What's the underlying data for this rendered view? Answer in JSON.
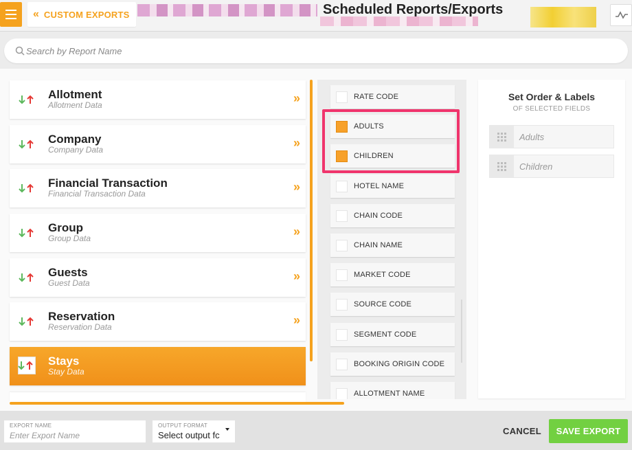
{
  "header": {
    "menu_icon": "hamburger-icon",
    "back_label": "CUSTOM EXPORTS",
    "title": "Scheduled Reports/Exports",
    "activity_icon": "activity-icon"
  },
  "search": {
    "placeholder": "Search by Report Name",
    "icon": "search-icon"
  },
  "categories": [
    {
      "name": "Allotment",
      "sub": "Allotment Data"
    },
    {
      "name": "Company",
      "sub": "Company Data"
    },
    {
      "name": "Financial Transaction",
      "sub": "Financial Transaction Data"
    },
    {
      "name": "Group",
      "sub": "Group Data"
    },
    {
      "name": "Guests",
      "sub": "Guest Data"
    },
    {
      "name": "Reservation",
      "sub": "Reservation Data"
    },
    {
      "name": "Stays",
      "sub": "Stay Data",
      "selected": true
    }
  ],
  "category_open_icon": "»",
  "fields": [
    {
      "label": "RATE CODE",
      "checked": false
    },
    {
      "label": "ADULTS",
      "checked": true
    },
    {
      "label": "CHILDREN",
      "checked": true
    },
    {
      "label": "HOTEL NAME",
      "checked": false
    },
    {
      "label": "CHAIN CODE",
      "checked": false
    },
    {
      "label": "CHAIN NAME",
      "checked": false
    },
    {
      "label": "MARKET CODE",
      "checked": false
    },
    {
      "label": "SOURCE CODE",
      "checked": false
    },
    {
      "label": "SEGMENT CODE",
      "checked": false
    },
    {
      "label": "BOOKING ORIGIN CODE",
      "checked": false
    },
    {
      "label": "ALLOTMENT NAME",
      "checked": false
    }
  ],
  "order_panel": {
    "title": "Set Order & Labels",
    "subtitle": "OF SELECTED FIELDS",
    "items": [
      "Adults",
      "Children"
    ]
  },
  "footer": {
    "export_name_caption": "EXPORT NAME",
    "export_name_placeholder": "Enter Export Name",
    "output_format_caption": "OUTPUT FORMAT",
    "output_format_value": "Select output fc",
    "cancel_label": "CANCEL",
    "save_label": "SAVE EXPORT"
  },
  "colors": {
    "accent": "#f5a21e",
    "highlight": "#f0346c",
    "save": "#72d041",
    "arrow_down": "#5cb85c",
    "arrow_up": "#e53935"
  }
}
